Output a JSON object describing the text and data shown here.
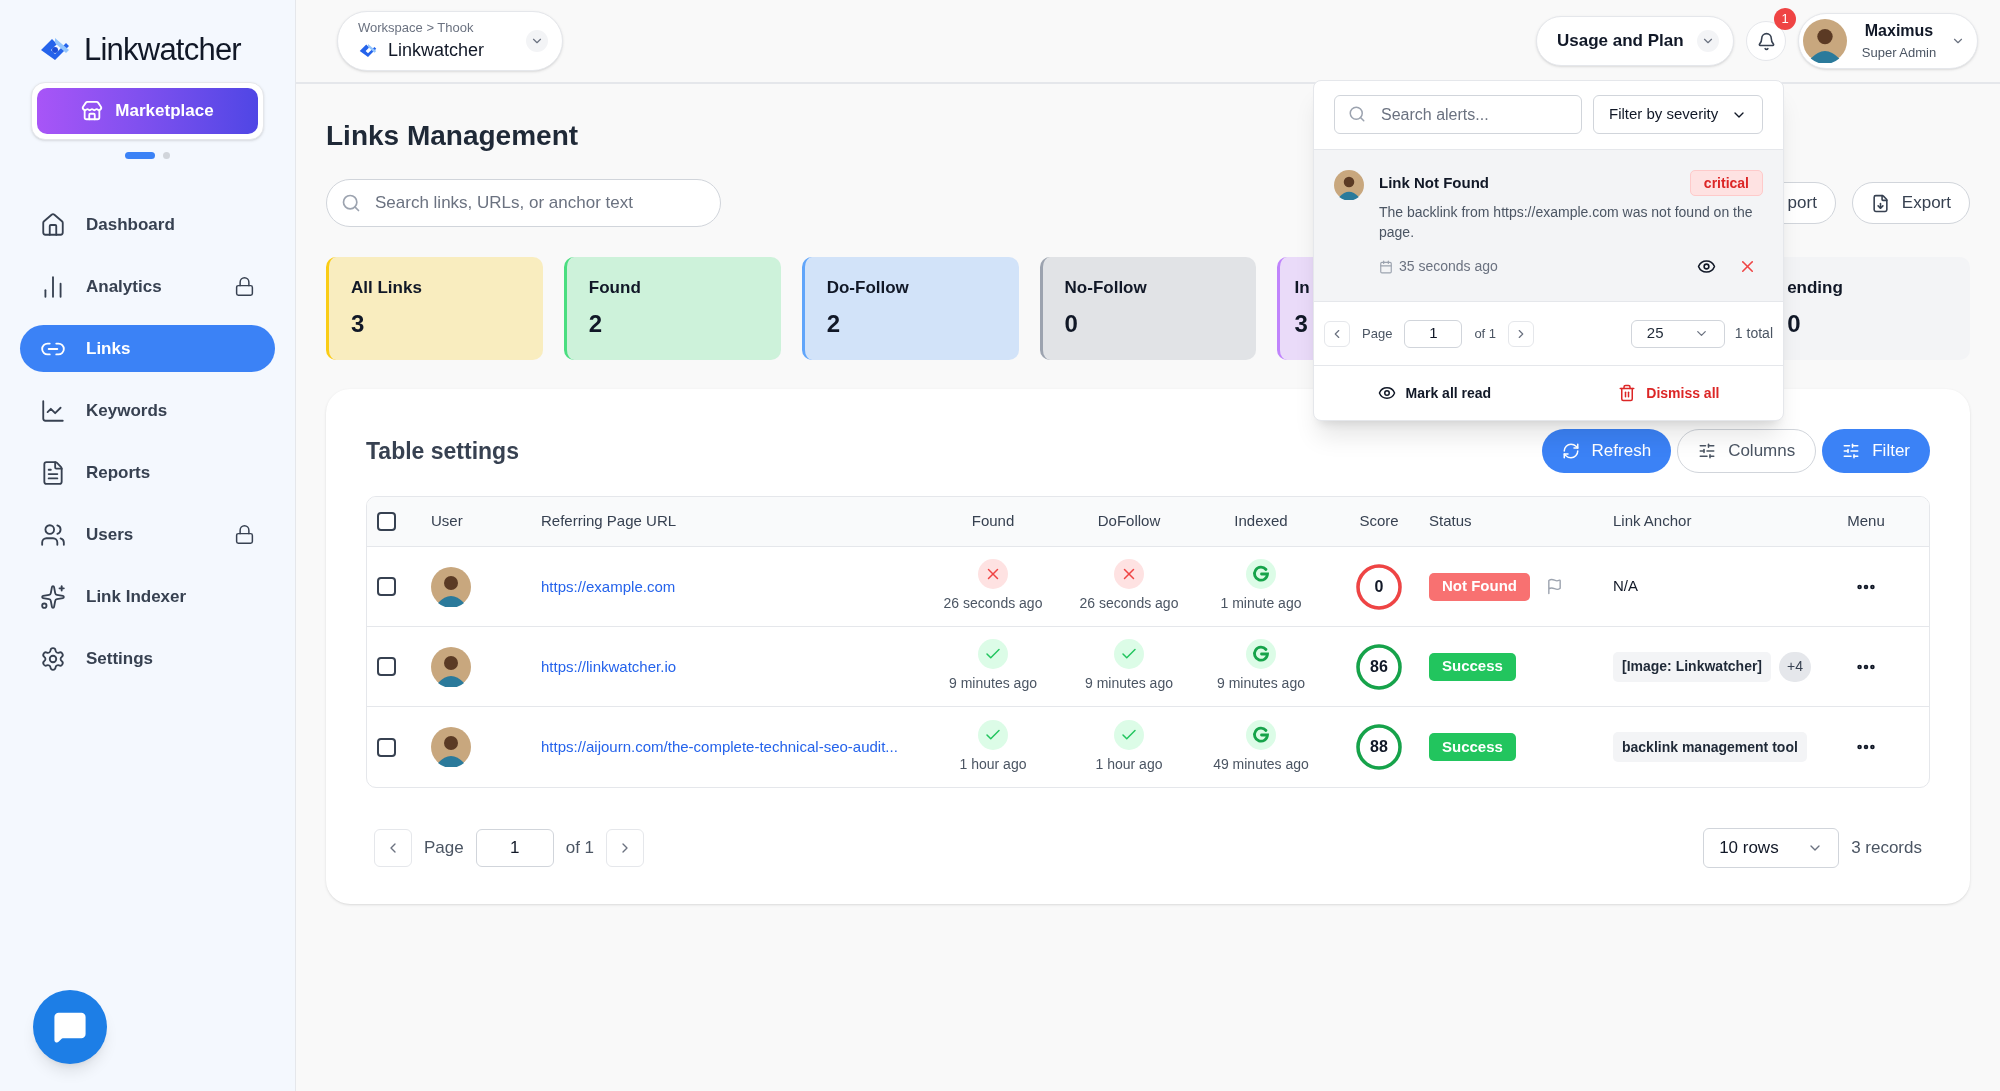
{
  "sidebar": {
    "brand": "Linkwatcher",
    "marketplace": "Marketplace",
    "carousel_dots": [
      {
        "selected": true
      },
      {
        "selected": false
      }
    ],
    "items": [
      {
        "label": "Dashboard",
        "selected": false,
        "locked": false
      },
      {
        "label": "Analytics",
        "selected": false,
        "locked": true
      },
      {
        "label": "Links",
        "selected": true,
        "locked": false
      },
      {
        "label": "Keywords",
        "selected": false,
        "locked": false
      },
      {
        "label": "Reports",
        "selected": false,
        "locked": false
      },
      {
        "label": "Users",
        "selected": false,
        "locked": true
      },
      {
        "label": "Link Indexer",
        "selected": false,
        "locked": false
      },
      {
        "label": "Settings",
        "selected": false,
        "locked": false
      }
    ]
  },
  "header": {
    "workspace": {
      "path": "Workspace > Thook",
      "name": "Linkwatcher"
    },
    "plan_button": "Usage and Plan",
    "notifications": {
      "count": "1"
    },
    "user": {
      "name": "Maximus",
      "role": "Super Admin"
    }
  },
  "page": {
    "title": "Links Management",
    "search": {
      "placeholder": "Search links, URLs, or anchor text"
    },
    "actions": [
      {
        "label": "port"
      },
      {
        "label": "Export"
      }
    ]
  },
  "stats": [
    {
      "label": "All Links",
      "value": "3",
      "color": "#facc15"
    },
    {
      "label": "Found",
      "value": "2",
      "color": "#4ade80"
    },
    {
      "label": "Do-Follow",
      "value": "2",
      "color": "#60a5fa"
    },
    {
      "label": "No-Follow",
      "value": "0",
      "color": "#9ca3af"
    },
    {
      "label": "In",
      "value": "3",
      "color": "#c084fc"
    },
    {
      "label": "ending",
      "value": "0"
    }
  ],
  "table": {
    "title": "Table settings",
    "buttons": [
      {
        "label": "Refresh",
        "kind": "primary"
      },
      {
        "label": "Columns",
        "kind": "outline"
      },
      {
        "label": "Filter",
        "kind": "primary"
      }
    ],
    "header_checkbox": {
      "checked": false
    },
    "columns": [
      "User",
      "Referring Page URL",
      "Found",
      "DoFollow",
      "Indexed",
      "Score",
      "Status",
      "Link Anchor",
      "Menu"
    ],
    "rows": [
      {
        "checked": false,
        "url": "https://example.com",
        "found": {
          "ok": false,
          "time": "26 seconds ago"
        },
        "dofollow": {
          "ok": false,
          "time": "26 seconds ago"
        },
        "indexed": {
          "time": "1 minute ago"
        },
        "score": {
          "value": "0",
          "color": "#ef4444"
        },
        "status": {
          "label": "Not Found",
          "kind": "error"
        },
        "flag": true,
        "anchors": [
          {
            "text": "N/A",
            "kind": "plain"
          }
        ]
      },
      {
        "checked": false,
        "url": "https://linkwatcher.io",
        "found": {
          "ok": true,
          "time": "9 minutes ago"
        },
        "dofollow": {
          "ok": true,
          "time": "9 minutes ago"
        },
        "indexed": {
          "time": "9 minutes ago"
        },
        "score": {
          "value": "86",
          "color": "#16a34a"
        },
        "status": {
          "label": "Success",
          "kind": "success"
        },
        "flag": false,
        "anchors": [
          {
            "text": "[Image: Linkwatcher]",
            "kind": "tag"
          },
          {
            "text": "+4",
            "kind": "more"
          }
        ]
      },
      {
        "checked": false,
        "url": "https://aijourn.com/the-complete-technical-seo-audit...",
        "found": {
          "ok": true,
          "time": "1 hour ago"
        },
        "dofollow": {
          "ok": true,
          "time": "1 hour ago"
        },
        "indexed": {
          "time": "49 minutes ago"
        },
        "score": {
          "value": "88",
          "color": "#16a34a"
        },
        "status": {
          "label": "Success",
          "kind": "success"
        },
        "flag": false,
        "anchors": [
          {
            "text": "backlink management tool",
            "kind": "tag"
          }
        ]
      }
    ],
    "pagination": {
      "page_label": "Page",
      "page": "1",
      "of": "of 1",
      "rows": "10 rows",
      "records": "3 records"
    }
  },
  "alerts_popup": {
    "search_placeholder": "Search alerts...",
    "filter": "Filter by severity",
    "alerts": [
      {
        "title": "Link Not Found",
        "severity": "critical",
        "message": "The backlink from https://example.com was not found on the page.",
        "time": "35 seconds ago"
      }
    ],
    "pagination": {
      "page_label": "Page",
      "page": "1",
      "of": "of 1",
      "per_page": "25",
      "total": "1 total"
    },
    "mark_all": "Mark all read",
    "dismiss_all": "Dismiss all"
  }
}
